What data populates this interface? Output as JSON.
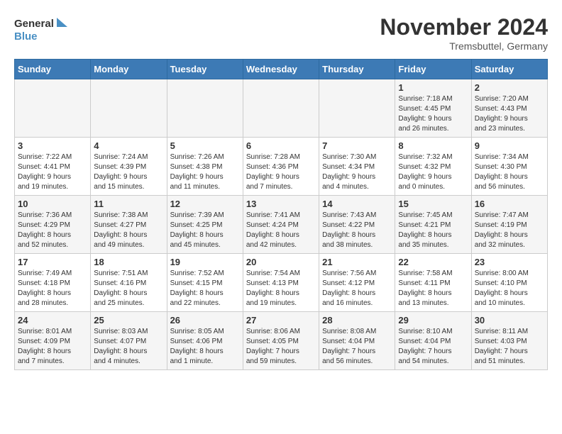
{
  "header": {
    "logo_line1": "General",
    "logo_line2": "Blue",
    "month_title": "November 2024",
    "location": "Tremsbuttel, Germany"
  },
  "weekdays": [
    "Sunday",
    "Monday",
    "Tuesday",
    "Wednesday",
    "Thursday",
    "Friday",
    "Saturday"
  ],
  "weeks": [
    [
      {
        "day": "",
        "info": ""
      },
      {
        "day": "",
        "info": ""
      },
      {
        "day": "",
        "info": ""
      },
      {
        "day": "",
        "info": ""
      },
      {
        "day": "",
        "info": ""
      },
      {
        "day": "1",
        "info": "Sunrise: 7:18 AM\nSunset: 4:45 PM\nDaylight: 9 hours\nand 26 minutes."
      },
      {
        "day": "2",
        "info": "Sunrise: 7:20 AM\nSunset: 4:43 PM\nDaylight: 9 hours\nand 23 minutes."
      }
    ],
    [
      {
        "day": "3",
        "info": "Sunrise: 7:22 AM\nSunset: 4:41 PM\nDaylight: 9 hours\nand 19 minutes."
      },
      {
        "day": "4",
        "info": "Sunrise: 7:24 AM\nSunset: 4:39 PM\nDaylight: 9 hours\nand 15 minutes."
      },
      {
        "day": "5",
        "info": "Sunrise: 7:26 AM\nSunset: 4:38 PM\nDaylight: 9 hours\nand 11 minutes."
      },
      {
        "day": "6",
        "info": "Sunrise: 7:28 AM\nSunset: 4:36 PM\nDaylight: 9 hours\nand 7 minutes."
      },
      {
        "day": "7",
        "info": "Sunrise: 7:30 AM\nSunset: 4:34 PM\nDaylight: 9 hours\nand 4 minutes."
      },
      {
        "day": "8",
        "info": "Sunrise: 7:32 AM\nSunset: 4:32 PM\nDaylight: 9 hours\nand 0 minutes."
      },
      {
        "day": "9",
        "info": "Sunrise: 7:34 AM\nSunset: 4:30 PM\nDaylight: 8 hours\nand 56 minutes."
      }
    ],
    [
      {
        "day": "10",
        "info": "Sunrise: 7:36 AM\nSunset: 4:29 PM\nDaylight: 8 hours\nand 52 minutes."
      },
      {
        "day": "11",
        "info": "Sunrise: 7:38 AM\nSunset: 4:27 PM\nDaylight: 8 hours\nand 49 minutes."
      },
      {
        "day": "12",
        "info": "Sunrise: 7:39 AM\nSunset: 4:25 PM\nDaylight: 8 hours\nand 45 minutes."
      },
      {
        "day": "13",
        "info": "Sunrise: 7:41 AM\nSunset: 4:24 PM\nDaylight: 8 hours\nand 42 minutes."
      },
      {
        "day": "14",
        "info": "Sunrise: 7:43 AM\nSunset: 4:22 PM\nDaylight: 8 hours\nand 38 minutes."
      },
      {
        "day": "15",
        "info": "Sunrise: 7:45 AM\nSunset: 4:21 PM\nDaylight: 8 hours\nand 35 minutes."
      },
      {
        "day": "16",
        "info": "Sunrise: 7:47 AM\nSunset: 4:19 PM\nDaylight: 8 hours\nand 32 minutes."
      }
    ],
    [
      {
        "day": "17",
        "info": "Sunrise: 7:49 AM\nSunset: 4:18 PM\nDaylight: 8 hours\nand 28 minutes."
      },
      {
        "day": "18",
        "info": "Sunrise: 7:51 AM\nSunset: 4:16 PM\nDaylight: 8 hours\nand 25 minutes."
      },
      {
        "day": "19",
        "info": "Sunrise: 7:52 AM\nSunset: 4:15 PM\nDaylight: 8 hours\nand 22 minutes."
      },
      {
        "day": "20",
        "info": "Sunrise: 7:54 AM\nSunset: 4:13 PM\nDaylight: 8 hours\nand 19 minutes."
      },
      {
        "day": "21",
        "info": "Sunrise: 7:56 AM\nSunset: 4:12 PM\nDaylight: 8 hours\nand 16 minutes."
      },
      {
        "day": "22",
        "info": "Sunrise: 7:58 AM\nSunset: 4:11 PM\nDaylight: 8 hours\nand 13 minutes."
      },
      {
        "day": "23",
        "info": "Sunrise: 8:00 AM\nSunset: 4:10 PM\nDaylight: 8 hours\nand 10 minutes."
      }
    ],
    [
      {
        "day": "24",
        "info": "Sunrise: 8:01 AM\nSunset: 4:09 PM\nDaylight: 8 hours\nand 7 minutes."
      },
      {
        "day": "25",
        "info": "Sunrise: 8:03 AM\nSunset: 4:07 PM\nDaylight: 8 hours\nand 4 minutes."
      },
      {
        "day": "26",
        "info": "Sunrise: 8:05 AM\nSunset: 4:06 PM\nDaylight: 8 hours\nand 1 minute."
      },
      {
        "day": "27",
        "info": "Sunrise: 8:06 AM\nSunset: 4:05 PM\nDaylight: 7 hours\nand 59 minutes."
      },
      {
        "day": "28",
        "info": "Sunrise: 8:08 AM\nSunset: 4:04 PM\nDaylight: 7 hours\nand 56 minutes."
      },
      {
        "day": "29",
        "info": "Sunrise: 8:10 AM\nSunset: 4:04 PM\nDaylight: 7 hours\nand 54 minutes."
      },
      {
        "day": "30",
        "info": "Sunrise: 8:11 AM\nSunset: 4:03 PM\nDaylight: 7 hours\nand 51 minutes."
      }
    ]
  ]
}
